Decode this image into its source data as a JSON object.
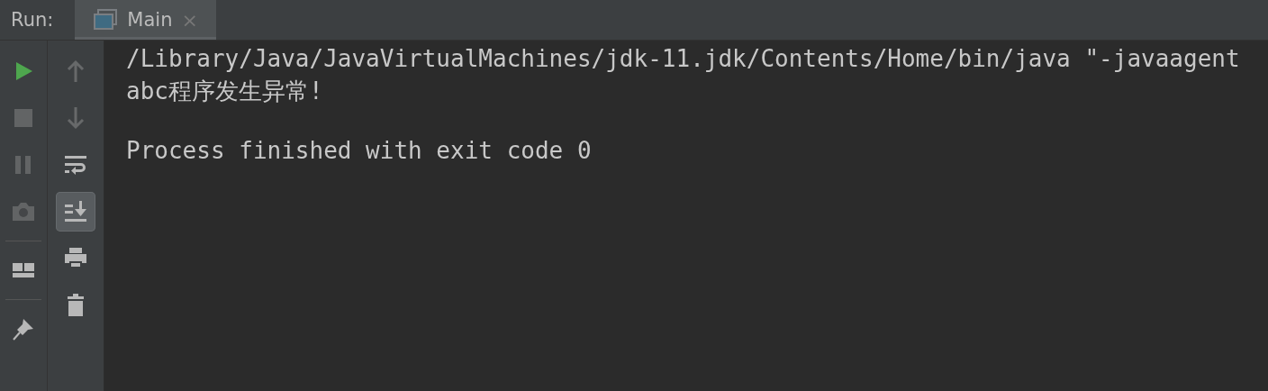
{
  "run_panel": {
    "label": "Run:",
    "tabs": [
      {
        "label": "Main",
        "selected": true,
        "close": "×"
      }
    ]
  },
  "left_toolbar": [
    {
      "kind": "run",
      "disabled": false
    },
    {
      "kind": "stop",
      "disabled": true
    },
    {
      "kind": "pause",
      "disabled": true
    },
    {
      "kind": "camera",
      "disabled": true
    },
    {
      "kind": "separator"
    },
    {
      "kind": "layout",
      "disabled": false
    },
    {
      "kind": "separator"
    },
    {
      "kind": "pin",
      "disabled": false
    }
  ],
  "console_toolbar": [
    {
      "kind": "up",
      "disabled": true,
      "selected": false
    },
    {
      "kind": "down",
      "disabled": true,
      "selected": false
    },
    {
      "kind": "wrap",
      "disabled": false,
      "selected": false
    },
    {
      "kind": "scroll-end",
      "disabled": false,
      "selected": true
    },
    {
      "kind": "print",
      "disabled": false,
      "selected": false
    },
    {
      "kind": "trash",
      "disabled": false,
      "selected": false
    }
  ],
  "console": {
    "output_lines": [
      "/Library/Java/JavaVirtualMachines/jdk-11.jdk/Contents/Home/bin/java \"-javaagent",
      "abc程序发生异常!"
    ],
    "exit_message": "Process finished with exit code 0"
  }
}
